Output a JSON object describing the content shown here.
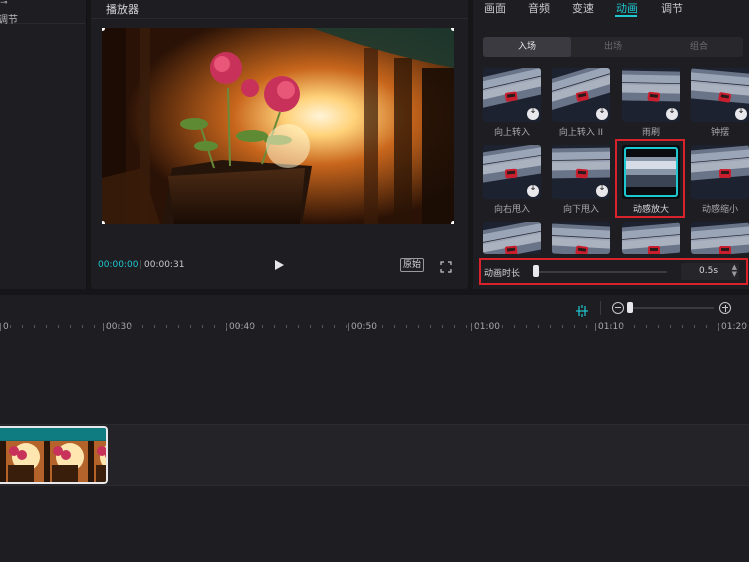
{
  "media_panel": {
    "tab_label": "调节",
    "tab_icon": "sliders-icon"
  },
  "player": {
    "title": "播放器",
    "current_time": "00:00:00",
    "total_time": "00:00:31",
    "original_button": "原始",
    "play_icon": "play-icon",
    "fullscreen_icon": "fullscreen-icon"
  },
  "properties": {
    "tabs": [
      "画面",
      "音频",
      "变速",
      "动画",
      "调节"
    ],
    "active_tab": "动画",
    "sub_tabs": [
      "入场",
      "出场",
      "组合"
    ],
    "active_sub_tab": "入场",
    "animations": [
      {
        "label": "向上转入",
        "download": true
      },
      {
        "label": "向上转入 II",
        "download": true
      },
      {
        "label": "雨刷",
        "download": true
      },
      {
        "label": "钟摆",
        "download": true
      },
      {
        "label": "向右甩入",
        "download": true
      },
      {
        "label": "向下甩入",
        "download": true
      },
      {
        "label": "动感放大",
        "download": false,
        "selected": true
      },
      {
        "label": "动感缩小",
        "download": false
      },
      {
        "label": "",
        "download": false
      },
      {
        "label": "",
        "download": false
      },
      {
        "label": "",
        "download": false
      },
      {
        "label": "",
        "download": false
      }
    ],
    "duration": {
      "label": "动画时长",
      "value": "0.5s",
      "slider_fraction": 0.0
    }
  },
  "timeline": {
    "ruler": [
      "0",
      "00:30",
      "00:40",
      "00:50",
      "01:00",
      "01:10",
      "01:20"
    ],
    "clip_frames": 3,
    "icons": [
      "magnet-icon",
      "zoom-out-icon",
      "zoom-in-icon"
    ]
  },
  "colors": {
    "accent": "#1ec8d0",
    "highlight": "#d8222c",
    "panel": "#1e1e22",
    "background": "#161619"
  }
}
